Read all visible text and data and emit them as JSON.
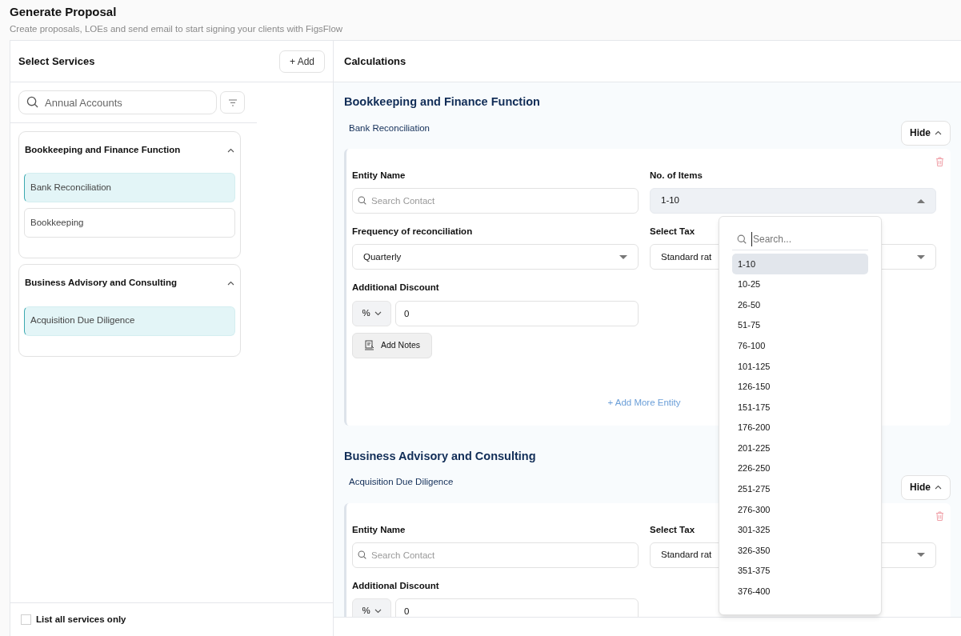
{
  "header": {
    "title": "Generate Proposal",
    "subtitle": "Create proposals, LOEs and send email to start signing your clients with FigsFlow"
  },
  "services_panel": {
    "title": "Select Services",
    "add_button": "+ Add",
    "search": {
      "value": "Annual Accounts"
    },
    "groups": [
      {
        "name": "Bookkeeping and Finance Function",
        "expanded": true,
        "items": [
          {
            "label": "Bank Reconciliation",
            "selected": true
          },
          {
            "label": "Bookkeeping",
            "selected": false
          }
        ]
      },
      {
        "name": "Business Advisory and Consulting",
        "expanded": true,
        "items": [
          {
            "label": "Acquisition Due Diligence",
            "selected": true
          }
        ]
      }
    ],
    "list_all": {
      "label": "List all services only",
      "checked": false
    }
  },
  "calculations": {
    "title": "Calculations",
    "sections": [
      {
        "title": "Bookkeeping and Finance Function",
        "service": "Bank Reconciliation",
        "hide_button": "Hide",
        "fields": [
          {
            "kind": "search",
            "label": "Entity Name",
            "placeholder": "Search Contact"
          },
          {
            "kind": "select",
            "label": "No. of Items",
            "value": "1-10",
            "open": true
          },
          {
            "kind": "select",
            "label": "Frequency of reconciliation",
            "value": "Quarterly",
            "open": false
          },
          {
            "kind": "select",
            "label": "Select Tax",
            "value": "Standard rat",
            "open": false
          },
          {
            "kind": "discount",
            "label": "Additional Discount",
            "unit": "%",
            "value": "0"
          }
        ],
        "notes_button": "Add Notes",
        "add_more": "+ Add More Entity"
      },
      {
        "title": "Business Advisory and Consulting",
        "service": "Acquisition Due Diligence",
        "hide_button": "Hide",
        "fields": [
          {
            "kind": "search",
            "label": "Entity Name",
            "placeholder": "Search Contact"
          },
          {
            "kind": "select",
            "label": "Select Tax",
            "value": "Standard rat",
            "open": false
          },
          {
            "kind": "discount",
            "label": "Additional Discount",
            "unit": "%",
            "value": "0"
          }
        ]
      }
    ]
  },
  "dropdown": {
    "placeholder": "Search...",
    "options": [
      {
        "label": "1-10",
        "selected": true
      },
      {
        "label": "10-25",
        "selected": false
      },
      {
        "label": "26-50",
        "selected": false
      },
      {
        "label": "51-75",
        "selected": false
      },
      {
        "label": "76-100",
        "selected": false
      },
      {
        "label": "101-125",
        "selected": false
      },
      {
        "label": "126-150",
        "selected": false
      },
      {
        "label": "151-175",
        "selected": false
      },
      {
        "label": "176-200",
        "selected": false
      },
      {
        "label": "201-225",
        "selected": false
      },
      {
        "label": "226-250",
        "selected": false
      },
      {
        "label": "251-275",
        "selected": false
      },
      {
        "label": "276-300",
        "selected": false
      },
      {
        "label": "301-325",
        "selected": false
      },
      {
        "label": "326-350",
        "selected": false
      },
      {
        "label": "351-375",
        "selected": false
      },
      {
        "label": "376-400",
        "selected": false
      }
    ]
  }
}
